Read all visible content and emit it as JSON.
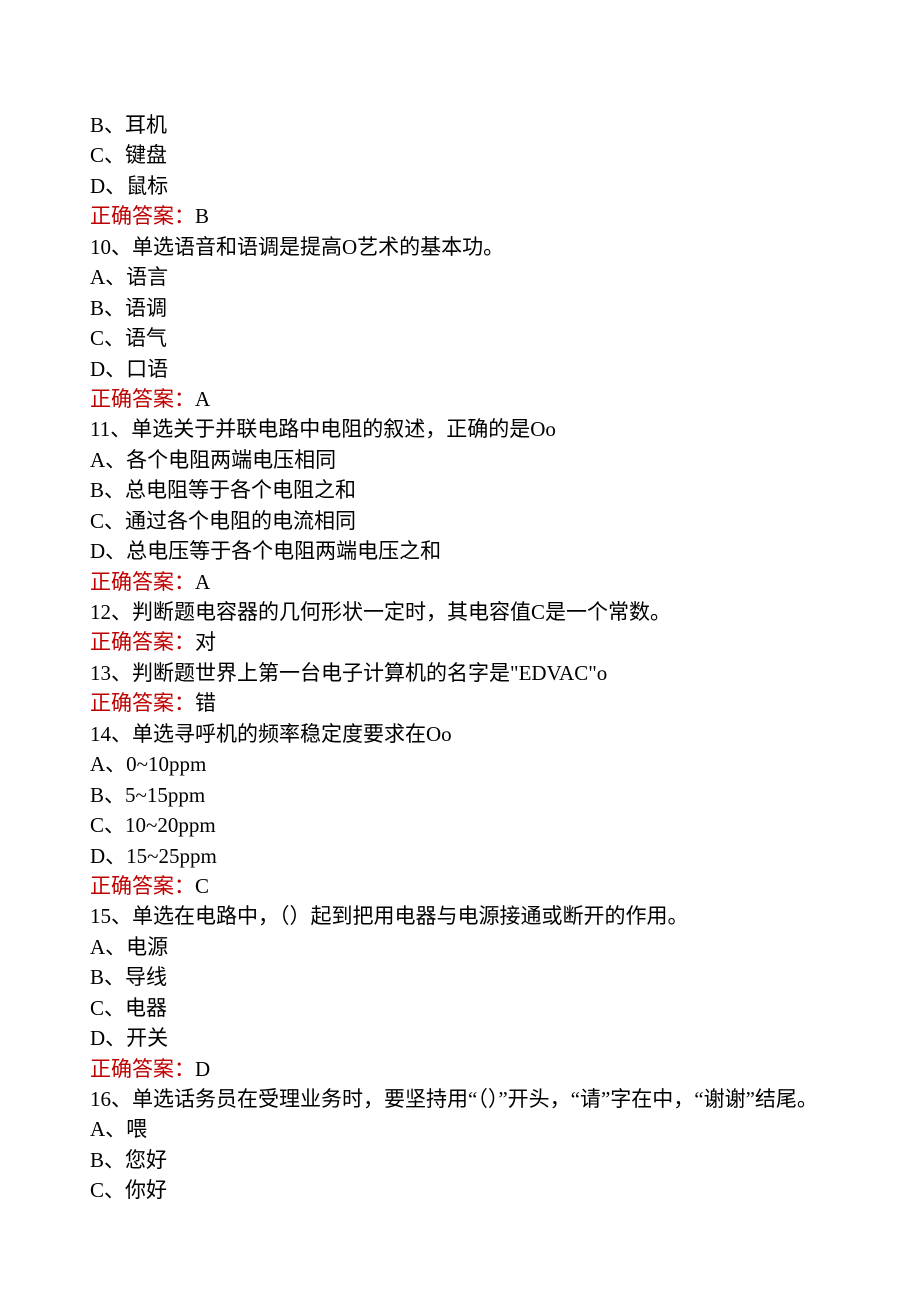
{
  "q9": {
    "optB": "B、耳机",
    "optC": "C、键盘",
    "optD": "D、鼠标",
    "answerLabel": "正确答案：",
    "answerValue": "B"
  },
  "q10": {
    "stem": "10、单选语音和语调是提高O艺术的基本功。",
    "optA": "A、语言",
    "optB": "B、语调",
    "optC": "C、语气",
    "optD": "D、口语",
    "answerLabel": "正确答案：",
    "answerValue": "A"
  },
  "q11": {
    "stem": "11、单选关于并联电路中电阻的叙述，正确的是Oo",
    "optA": "A、各个电阻两端电压相同",
    "optB": "B、总电阻等于各个电阻之和",
    "optC": "C、通过各个电阻的电流相同",
    "optD": "D、总电压等于各个电阻两端电压之和",
    "answerLabel": "正确答案：",
    "answerValue": "A"
  },
  "q12": {
    "stem": "12、判断题电容器的几何形状一定时，其电容值C是一个常数。",
    "answerLabel": "正确答案：",
    "answerValue": "对"
  },
  "q13": {
    "stem": "13、判断题世界上第一台电子计算机的名字是\"EDVAC\"o",
    "answerLabel": "正确答案：",
    "answerValue": "错"
  },
  "q14": {
    "stem": "14、单选寻呼机的频率稳定度要求在Oo",
    "optA": "A、0~10ppm",
    "optB": "B、5~15ppm",
    "optC": "C、10~20ppm",
    "optD": "D、15~25ppm",
    "answerLabel": "正确答案：",
    "answerValue": "C"
  },
  "q15": {
    "stem": "15、单选在电路中，（）起到把用电器与电源接通或断开的作用。",
    "optA": "A、电源",
    "optB": "B、导线",
    "optC": "C、电器",
    "optD": "D、开关",
    "answerLabel": "正确答案：",
    "answerValue": "D"
  },
  "q16": {
    "stem": "16、单选话务员在受理业务时，要坚持用“（）”开头，“请”字在中，“谢谢”结尾。",
    "optA": "A、喂",
    "optB": "B、您好",
    "optC": "C、你好"
  }
}
